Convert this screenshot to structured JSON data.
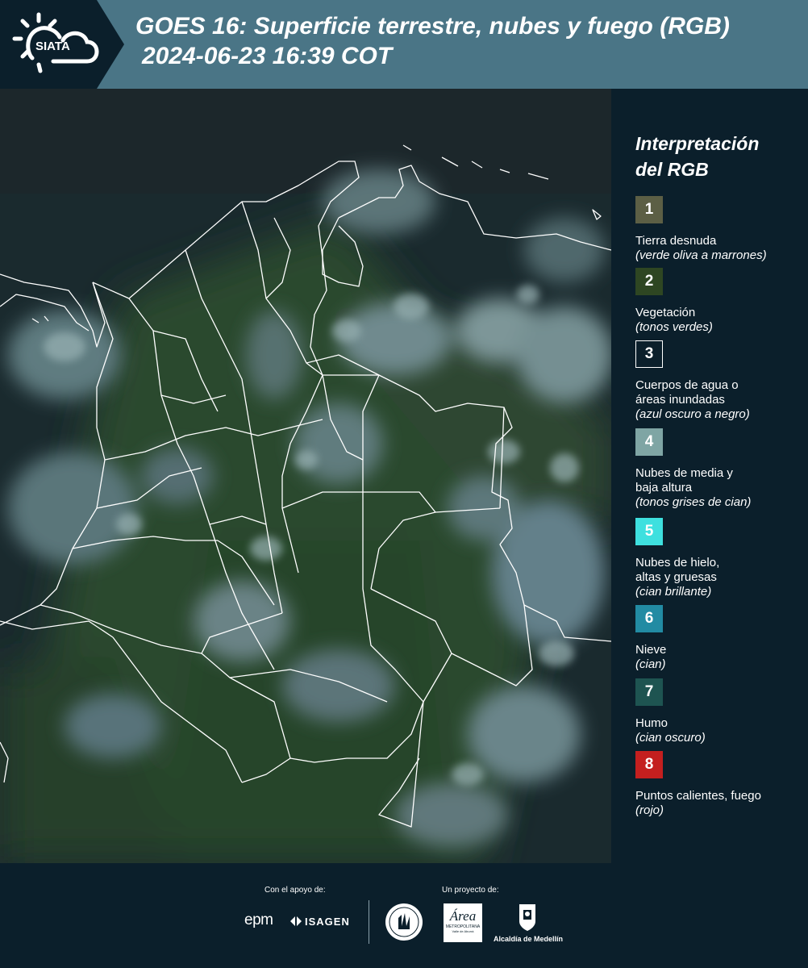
{
  "header": {
    "logo_text": "SIATA",
    "title_line1": "GOES 16: Superficie terrestre, nubes y fuego (RGB)",
    "title_line2": "2024-06-23 16:39 COT"
  },
  "legend": {
    "title_line1": "Interpretación",
    "title_line2": "del RGB",
    "items": [
      {
        "num": "1",
        "color": "#5c5f45",
        "label1": "Tierra desnuda",
        "label2": "",
        "note": "(verde oliva a marrones)"
      },
      {
        "num": "2",
        "color": "#2e4622",
        "label1": "Vegetación",
        "label2": "",
        "note": "(tonos verdes)"
      },
      {
        "num": "3",
        "color": "#0b1f2b",
        "label1": "Cuerpos de agua o",
        "label2": "áreas inundadas",
        "note": "(azul oscuro a negro)"
      },
      {
        "num": "4",
        "color": "#7fa5a4",
        "label1": "Nubes de media y",
        "label2": "baja altura",
        "note": "(tonos grises de cian)"
      },
      {
        "num": "5",
        "color": "#3ee0df",
        "label1": "Nubes de hielo,",
        "label2": "altas y gruesas",
        "note": "(cian brillante)"
      },
      {
        "num": "6",
        "color": "#228ba3",
        "label1": "Nieve",
        "label2": "",
        "note": "(cian)"
      },
      {
        "num": "7",
        "color": "#1e5451",
        "label1": "Humo",
        "label2": "",
        "note": "(cian oscuro)"
      },
      {
        "num": "8",
        "color": "#c41f1f",
        "label1": "Puntos calientes, fuego",
        "label2": "",
        "note": "(rojo)"
      }
    ]
  },
  "footer": {
    "support_label": "Con el apoyo de:",
    "project_label": "Un proyecto de:",
    "sponsor_epm": "epm",
    "sponsor_isagen": "ISAGEN",
    "sponsor_area": "Área",
    "sponsor_area_sub": "METROPOLITANA",
    "sponsor_area_sub2": "Valle de Aburrá",
    "sponsor_alcaldia": "Alcaldía de Medellín"
  }
}
